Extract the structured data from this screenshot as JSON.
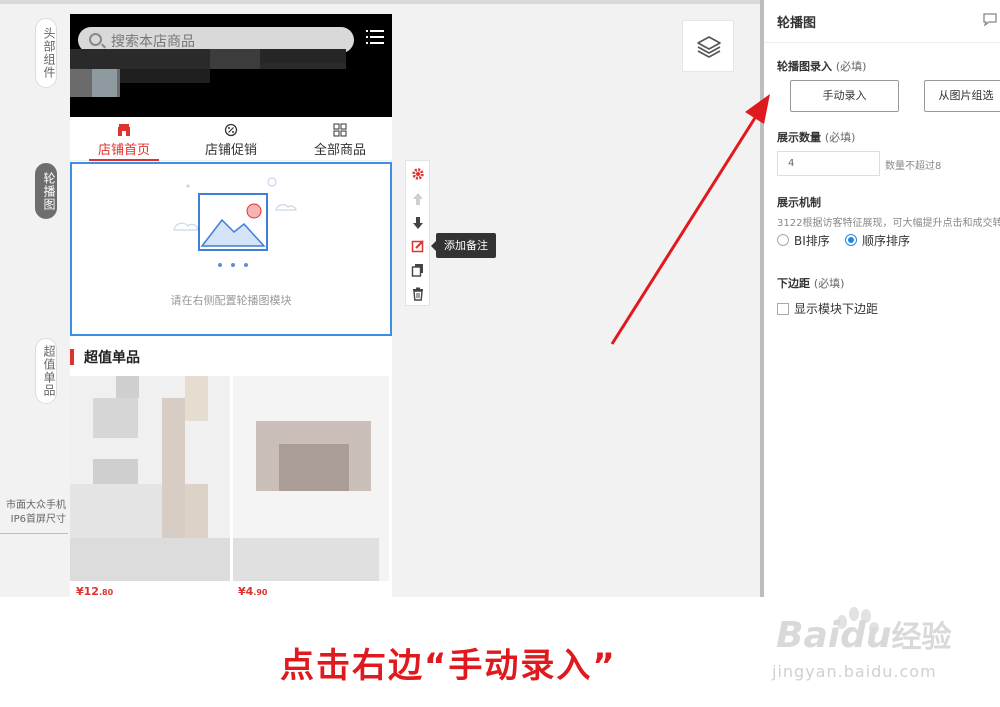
{
  "sidebar": {
    "tabs": [
      {
        "label": "头部组件"
      },
      {
        "label": "轮播图"
      },
      {
        "label": "超值单品"
      }
    ],
    "screen_note": "市面大众手机\nIP6首屏尺寸"
  },
  "phone": {
    "search_placeholder": "搜索本店商品",
    "nav": [
      {
        "label": "店铺首页",
        "icon": "shop-icon",
        "active": true
      },
      {
        "label": "店铺促销",
        "icon": "promo-icon",
        "active": false
      },
      {
        "label": "全部商品",
        "icon": "grid-icon",
        "active": false
      }
    ],
    "carousel_hint": "请在右侧配置轮播图模块",
    "section_title": "超值单品",
    "prices": [
      {
        "symbol": "¥",
        "main": "12",
        "decimal": ".80"
      },
      {
        "symbol": "¥",
        "main": "4",
        "decimal": ".90"
      }
    ]
  },
  "toolbar": {
    "tools": [
      "settings-icon",
      "move-up-icon",
      "move-down-icon",
      "edit-note-icon",
      "copy-icon",
      "delete-icon"
    ],
    "tooltip": "添加备注"
  },
  "panel": {
    "title": "轮播图",
    "entry_label": "轮播图录入",
    "entry_required": "(必填)",
    "manual_button": "手动录入",
    "from_group_button": "从图片组选",
    "count_label": "展示数量",
    "count_required": "(必填)",
    "count_value": "4",
    "count_hint": "数量不超过8",
    "mechanism_label": "展示机制",
    "mechanism_desc": "3122根据访客特征展现，可大幅提升点击和成交转",
    "radio_bi": "BI排序",
    "radio_seq": "顺序排序",
    "selected_mechanism": "顺序排序",
    "margin_label": "下边距",
    "margin_required": "(必填)",
    "margin_checkbox": "显示模块下边距",
    "margin_checked": false
  },
  "annotation": {
    "caption": "点击右边“手动录入”"
  },
  "watermark": {
    "brand": "Bai",
    "brand_suffix": "du",
    "product": "经验",
    "url": "jingyan.baidu.com"
  },
  "colors": {
    "accent_red": "#e0322d",
    "selection_blue": "#3d8ee6",
    "radio_blue": "#1e88e5",
    "caption_red": "#e0191e"
  }
}
